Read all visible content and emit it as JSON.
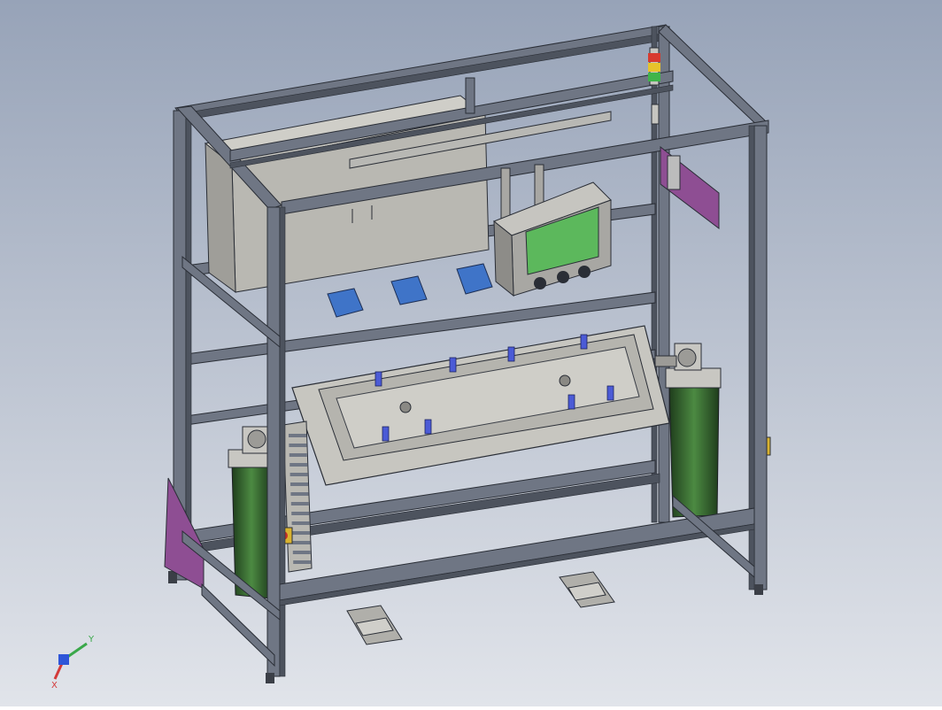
{
  "scene": {
    "background_top": "#97a3b8",
    "background_bottom": "#e1e4ea",
    "frame_color": "#6f7684",
    "frame_edge": "#2a2e36",
    "cabinet_color": "#b9b8b2",
    "panel_color": "#a8a7a3",
    "screen_color": "#5cb85c",
    "bin_color": "#3f74c8",
    "plate_color": "#8e4e93",
    "tower_color": "#3a6b33",
    "clamp_color": "#4b5bd6",
    "fixture_color": "#c7c6c0"
  },
  "triad": {
    "x_label": "X",
    "y_label": "Y",
    "x_color": "#d33a3a",
    "y_color": "#3aa84a",
    "z_color": "#2f56d8"
  },
  "signal_tower": {
    "colors": [
      "#d83a2e",
      "#e7c32b",
      "#3fb54a"
    ]
  }
}
